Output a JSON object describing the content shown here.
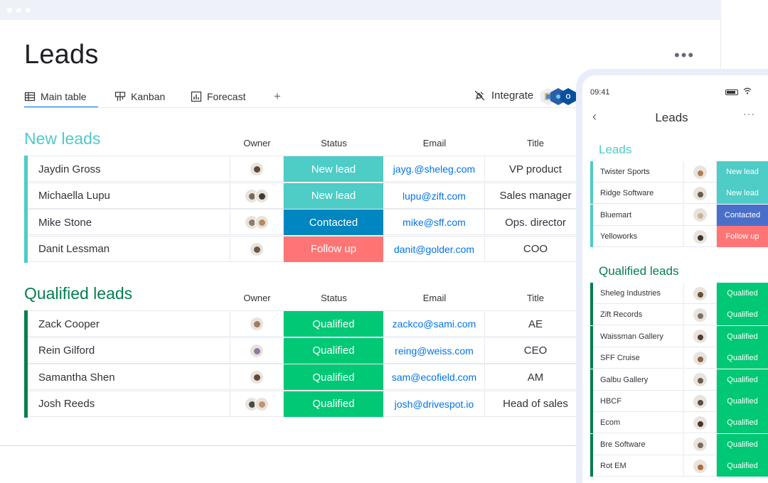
{
  "page": {
    "title": "Leads",
    "more": "•••"
  },
  "tabs": [
    {
      "label": "Main table",
      "icon": "table-icon"
    },
    {
      "label": "Kanban",
      "icon": "kanban-icon"
    },
    {
      "label": "Forecast",
      "icon": "chart-icon"
    }
  ],
  "tab_add": "+",
  "integrate": {
    "label": "Integrate"
  },
  "columns": {
    "owner": "Owner",
    "status": "Status",
    "email": "Email",
    "title": "Title"
  },
  "status_colors": {
    "New lead": "#4eccc6",
    "Contacted": "#0086c0",
    "Follow up": "#ff7575",
    "Qualified": "#00c875"
  },
  "groups": [
    {
      "title": "New leads",
      "color": "#4eccc6",
      "rows": [
        {
          "name": "Jaydin Gross",
          "status": "New lead",
          "email": "jayg.@sheleg.com",
          "title": "VP product",
          "avatars": [
            "#5b4a3f"
          ]
        },
        {
          "name": "Michaella Lupu",
          "status": "New lead",
          "email": "lupu@zift.com",
          "title": "Sales manager",
          "avatars": [
            "#7a6a5d",
            "#3f3a36"
          ]
        },
        {
          "name": "Mike Stone",
          "status": "Contacted",
          "email": "mike@sff.com",
          "title": "Ops. director",
          "avatars": [
            "#8e7d6a",
            "#b98a5e"
          ]
        },
        {
          "name": "Danit Lessman",
          "status": "Follow up",
          "email": "danit@golder.com",
          "title": "COO",
          "avatars": [
            "#6a584a"
          ]
        }
      ]
    },
    {
      "title": "Qualified leads",
      "color": "#037f4c",
      "rows": [
        {
          "name": "Zack Cooper",
          "status": "Qualified",
          "email": "zackco@sami.com",
          "title": "AE",
          "avatars": [
            "#a07c63"
          ]
        },
        {
          "name": "Rein Gilford",
          "status": "Qualified",
          "email": "reing@weiss.com",
          "title": "CEO",
          "avatars": [
            "#8c7aa0"
          ]
        },
        {
          "name": "Samantha Shen",
          "status": "Qualified",
          "email": "sam@ecofield.com",
          "title": "AM",
          "avatars": [
            "#5e4a3e"
          ]
        },
        {
          "name": "Josh Reeds",
          "status": "Qualified",
          "email": "josh@drivespot.io",
          "title": "Head of sales",
          "avatars": [
            "#4a4a4a",
            "#c09570"
          ]
        }
      ]
    }
  ],
  "phone": {
    "time": "09:41",
    "title": "Leads",
    "back": "‹",
    "more": "···",
    "groups": [
      {
        "title": "Leads",
        "color": "#4eccc6",
        "rows": [
          {
            "name": "Twister Sports",
            "status": "New lead",
            "avatar": "#b07d55"
          },
          {
            "name": "Ridge Software",
            "status": "New lead",
            "avatar": "#6b5a4d"
          },
          {
            "name": "Bluemart",
            "status": "Contacted",
            "avatar": "#c9b49a"
          },
          {
            "name": "Yelloworks",
            "status": "Follow up",
            "avatar": "#3e3530"
          }
        ]
      },
      {
        "title": "Qualified leads",
        "color": "#037f4c",
        "rows": [
          {
            "name": "Sheleg Industries",
            "status": "Qualified",
            "avatar": "#6b5035"
          },
          {
            "name": "Zift Records",
            "status": "Qualified",
            "avatar": "#7d6f66"
          },
          {
            "name": "Waissman Gallery",
            "status": "Qualified",
            "avatar": "#4f3b30"
          },
          {
            "name": "SFF Cruise",
            "status": "Qualified",
            "avatar": "#8a6248"
          },
          {
            "name": "Galbu Gallery",
            "status": "Qualified",
            "avatar": "#6a5a50"
          },
          {
            "name": "HBCF",
            "status": "Qualified",
            "avatar": "#5c4c42"
          },
          {
            "name": "Ecom",
            "status": "Qualified",
            "avatar": "#4a3328"
          },
          {
            "name": "Bre Software",
            "status": "Qualified",
            "avatar": "#7a6a60"
          },
          {
            "name": "Rot EM",
            "status": "Qualified",
            "avatar": "#b06a42"
          }
        ]
      }
    ]
  },
  "status_display": {
    "New lead": "#4eccc6",
    "Contacted": "#4a6fc9",
    "Follow up": "#ff7575",
    "Qualified": "#00c875"
  }
}
